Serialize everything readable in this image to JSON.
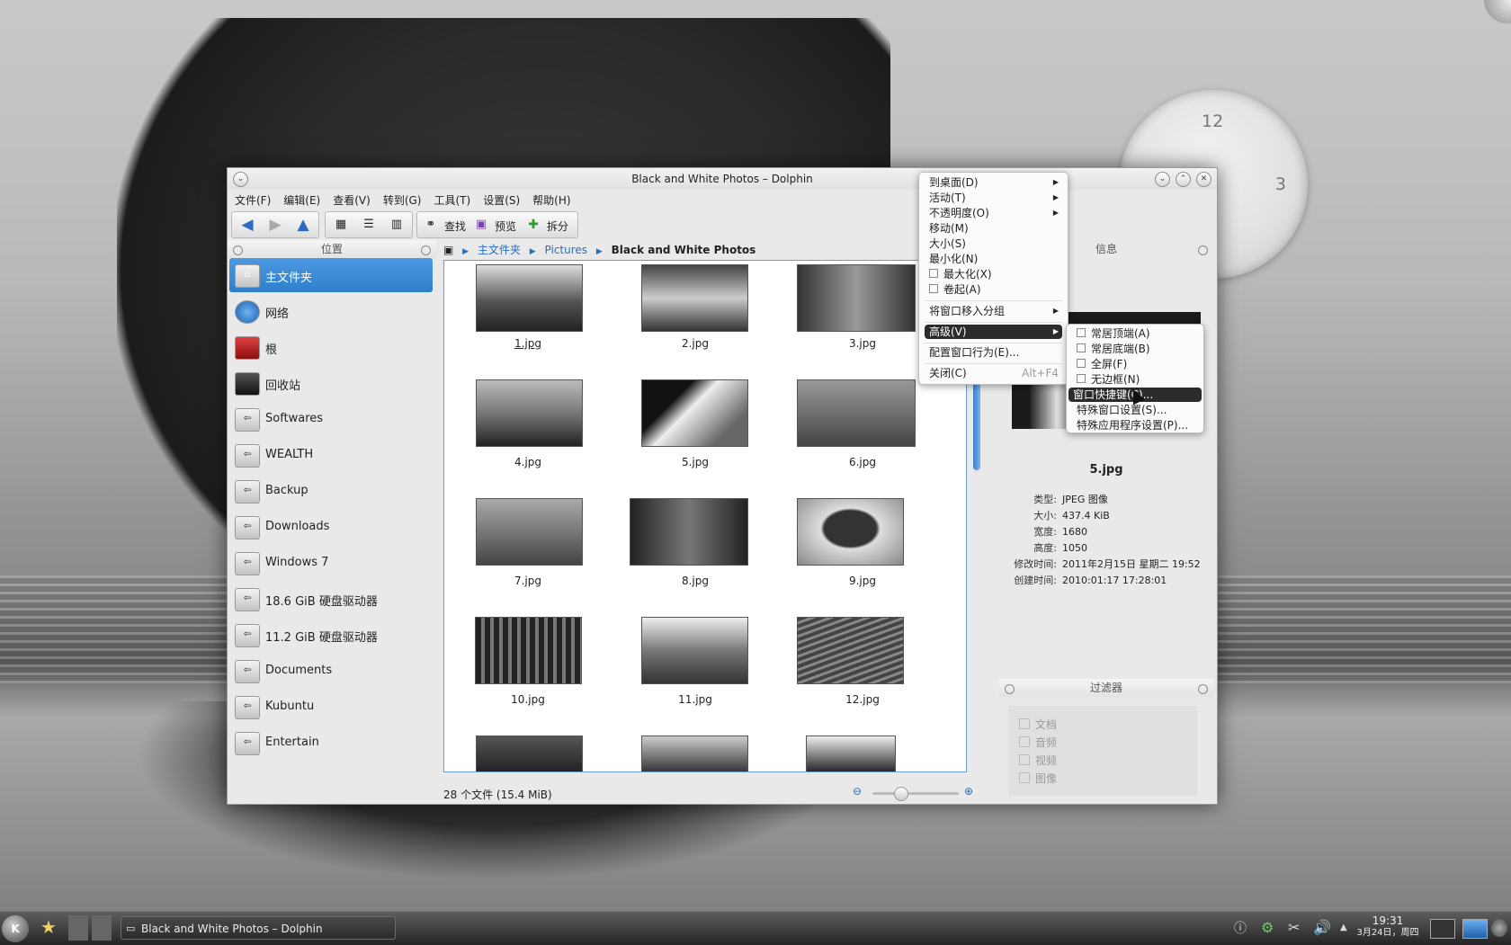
{
  "window": {
    "title": "Black and White Photos – Dolphin",
    "menu": [
      "文件(F)",
      "编辑(E)",
      "查看(V)",
      "转到(G)",
      "工具(T)",
      "设置(S)",
      "帮助(H)"
    ],
    "toolbar": {
      "find": "查找",
      "preview": "预览",
      "split": "拆分"
    }
  },
  "places": {
    "header": "位置",
    "items": [
      {
        "label": "主文件夹",
        "icon": "home-folder-icon",
        "selected": true
      },
      {
        "label": "网络",
        "icon": "network-globe-icon"
      },
      {
        "label": "根",
        "icon": "root-folder-icon"
      },
      {
        "label": "回收站",
        "icon": "trash-icon"
      },
      {
        "label": "Softwares",
        "icon": "drive-icon"
      },
      {
        "label": "WEALTH",
        "icon": "drive-icon"
      },
      {
        "label": "Backup",
        "icon": "drive-icon"
      },
      {
        "label": "Downloads",
        "icon": "drive-icon"
      },
      {
        "label": "Windows 7",
        "icon": "drive-icon"
      },
      {
        "label": "18.6 GiB 硬盘驱动器",
        "icon": "drive-icon"
      },
      {
        "label": "11.2 GiB 硬盘驱动器",
        "icon": "drive-icon"
      },
      {
        "label": "Documents",
        "icon": "drive-icon"
      },
      {
        "label": "Kubuntu",
        "icon": "drive-icon"
      },
      {
        "label": "Entertain",
        "icon": "drive-icon"
      }
    ]
  },
  "breadcrumb": [
    "主文件夹",
    "Pictures",
    "Black and White Photos"
  ],
  "files": [
    "1.jpg",
    "2.jpg",
    "3.jpg",
    "4.jpg",
    "5.jpg",
    "6.jpg",
    "7.jpg",
    "8.jpg",
    "9.jpg",
    "10.jpg",
    "11.jpg",
    "12.jpg"
  ],
  "status": "28 个文件 (15.4 MiB)",
  "info": {
    "header": "信息",
    "name": "5.jpg",
    "rows": [
      {
        "k": "类型:",
        "v": "JPEG 图像"
      },
      {
        "k": "大小:",
        "v": "437.4 KiB"
      },
      {
        "k": "宽度:",
        "v": "1680"
      },
      {
        "k": "高度:",
        "v": "1050"
      },
      {
        "k": "修改时间:",
        "v": "2011年2月15日 星期二 19:52"
      },
      {
        "k": "创建时间:",
        "v": "2010:01:17 17:28:01"
      }
    ]
  },
  "filter": {
    "header": "过滤器",
    "items": [
      "文档",
      "音频",
      "视频",
      "图像"
    ]
  },
  "context_menu": {
    "items": [
      {
        "label": "到桌面(D)",
        "submenu": true
      },
      {
        "label": "活动(T)",
        "submenu": true
      },
      {
        "label": "不透明度(O)",
        "submenu": true
      },
      {
        "label": "移动(M)"
      },
      {
        "label": "大小(S)"
      },
      {
        "label": "最小化(N)"
      },
      {
        "label": "最大化(X)",
        "check": true
      },
      {
        "label": "卷起(A)",
        "check": true
      },
      {
        "label": "将窗口移入分组",
        "submenu": true
      },
      {
        "label": "高级(V)",
        "submenu": true,
        "highlight": true
      },
      {
        "label": "配置窗口行为(E)..."
      },
      {
        "label": "关闭(C)",
        "shortcut": "Alt+F4"
      }
    ],
    "advanced": [
      {
        "label": "常居顶端(A)",
        "check": true
      },
      {
        "label": "常居底端(B)",
        "check": true
      },
      {
        "label": "全屏(F)",
        "check": true
      },
      {
        "label": "无边框(N)",
        "check": true
      },
      {
        "label": "窗口快捷键(C)...",
        "highlight": true
      },
      {
        "label": "特殊窗口设置(S)..."
      },
      {
        "label": "特殊应用程序设置(P)..."
      }
    ]
  },
  "clock": {
    "n12": "12",
    "n3": "3"
  },
  "taskbar": {
    "task": "Black and White Photos – Dolphin",
    "time": "19:31",
    "date": "3月24日，周四"
  }
}
